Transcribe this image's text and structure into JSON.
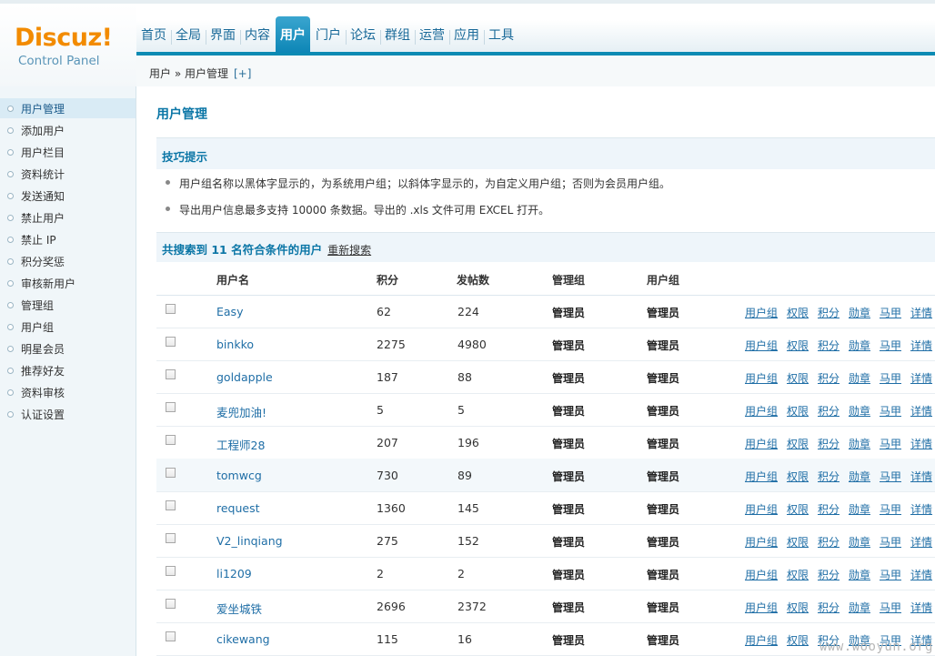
{
  "logo": {
    "brand": "Discuz!",
    "subtitle": "Control Panel"
  },
  "nav": {
    "items": [
      "首页",
      "全局",
      "界面",
      "内容",
      "用户",
      "门户",
      "论坛",
      "群组",
      "运营",
      "应用",
      "工具"
    ],
    "active": "用户"
  },
  "breadcrumb": {
    "path": "用户 » 用户管理",
    "plus": "[+]"
  },
  "sidebar": {
    "items": [
      "用户管理",
      "添加用户",
      "用户栏目",
      "资料统计",
      "发送通知",
      "禁止用户",
      "禁止 IP",
      "积分奖惩",
      "审核新用户",
      "管理组",
      "用户组",
      "明星会员",
      "推荐好友",
      "资料审核",
      "认证设置"
    ],
    "active": "用户管理"
  },
  "page": {
    "title": "用户管理"
  },
  "tips": {
    "title": "技巧提示",
    "items": [
      "用户组名称以黑体字显示的，为系统用户组；以斜体字显示的，为自定义用户组；否则为会员用户组。",
      "导出用户信息最多支持 10000 条数据。导出的 .xls 文件可用 EXCEL 打开。"
    ]
  },
  "result": {
    "text": "共搜索到 11 名符合条件的用户",
    "research": "重新搜索"
  },
  "table": {
    "headers": [
      "用户名",
      "积分",
      "发帖数",
      "管理组",
      "用户组"
    ],
    "actions": [
      "用户组",
      "权限",
      "积分",
      "勋章",
      "马甲",
      "详情"
    ],
    "rows": [
      {
        "name": "Easy",
        "credits": "62",
        "posts": "224",
        "admin_group": "管理员",
        "user_group": "管理员"
      },
      {
        "name": "binkko",
        "credits": "2275",
        "posts": "4980",
        "admin_group": "管理员",
        "user_group": "管理员"
      },
      {
        "name": "goldapple",
        "credits": "187",
        "posts": "88",
        "admin_group": "管理员",
        "user_group": "管理员"
      },
      {
        "name": "麦兜加油!",
        "credits": "5",
        "posts": "5",
        "admin_group": "管理员",
        "user_group": "管理员"
      },
      {
        "name": "工程师28",
        "credits": "207",
        "posts": "196",
        "admin_group": "管理员",
        "user_group": "管理员"
      },
      {
        "name": "tomwcg",
        "credits": "730",
        "posts": "89",
        "admin_group": "管理员",
        "user_group": "管理员"
      },
      {
        "name": "request",
        "credits": "1360",
        "posts": "145",
        "admin_group": "管理员",
        "user_group": "管理员"
      },
      {
        "name": "V2_linqiang",
        "credits": "275",
        "posts": "152",
        "admin_group": "管理员",
        "user_group": "管理员"
      },
      {
        "name": "li1209",
        "credits": "2",
        "posts": "2",
        "admin_group": "管理员",
        "user_group": "管理员"
      },
      {
        "name": "爱坐城铁",
        "credits": "2696",
        "posts": "2372",
        "admin_group": "管理员",
        "user_group": "管理员"
      },
      {
        "name": "cikewang",
        "credits": "115",
        "posts": "16",
        "admin_group": "管理员",
        "user_group": "管理员"
      }
    ],
    "highlighted_row": "tomwcg"
  },
  "watermark": "www.wooyun.org"
}
